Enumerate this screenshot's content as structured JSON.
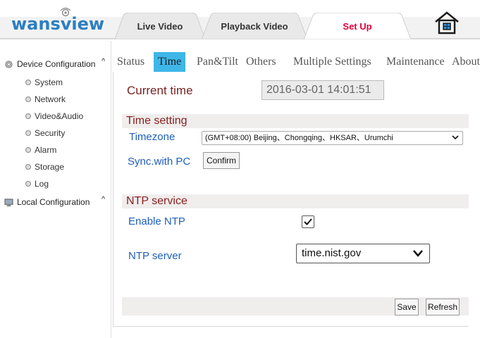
{
  "header": {
    "logo_text": "wansview",
    "tabs": [
      {
        "label": "Live Video"
      },
      {
        "label": "Playback Video"
      },
      {
        "label": "Set Up"
      }
    ],
    "active_tab_color": "#e0003a",
    "home_icon": "home-icon"
  },
  "sidebar": {
    "groups": [
      {
        "label": "Device Configuration",
        "icon": "gear-icon",
        "caret": "^",
        "items": [
          {
            "label": "System"
          },
          {
            "label": "Network"
          },
          {
            "label": "Video&Audio"
          },
          {
            "label": "Security"
          },
          {
            "label": "Alarm"
          },
          {
            "label": "Storage"
          },
          {
            "label": "Log"
          }
        ]
      },
      {
        "label": "Local Configuration",
        "icon": "computer-icon",
        "caret": "^"
      }
    ]
  },
  "subtabs": [
    {
      "label": "Status"
    },
    {
      "label": "Time"
    },
    {
      "label": "Pan&Tilt"
    },
    {
      "label": "Others"
    },
    {
      "label": "Multiple Settings"
    },
    {
      "label": "Maintenance"
    },
    {
      "label": "About"
    }
  ],
  "active_subtab": "Time",
  "accent_color": "#3eb6e8",
  "current_time": {
    "label": "Current time",
    "value": "2016-03-01  14:01:51"
  },
  "time_setting": {
    "title": "Time setting",
    "timezone_label": "Timezone",
    "timezone_value": "(GMT+08:00) Beijing、Chongqing、HKSAR、Urumchi",
    "sync_label": "Sync.with PC",
    "confirm_label": "Confirm"
  },
  "ntp": {
    "title": "NTP service",
    "enable_label": "Enable NTP",
    "enabled": true,
    "server_label": "NTP server",
    "server_value": "time.nist.gov"
  },
  "actions": {
    "save_label": "Save",
    "refresh_label": "Refresh"
  }
}
